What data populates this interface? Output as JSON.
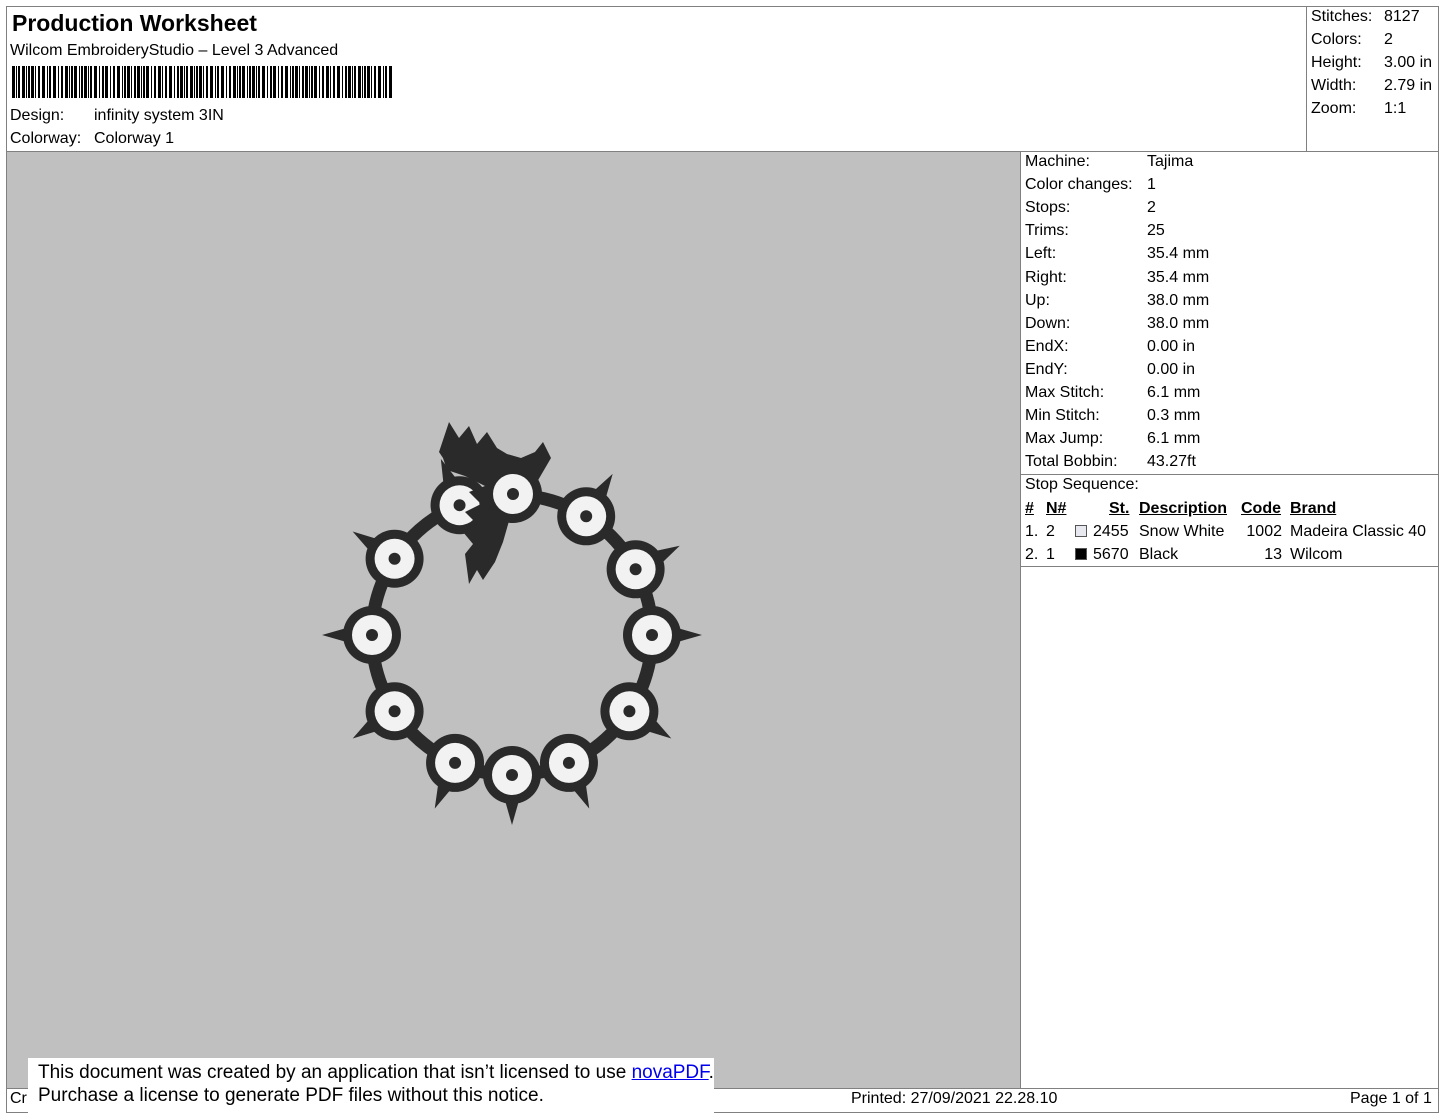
{
  "header": {
    "title": "Production Worksheet",
    "application": "Wilcom EmbroideryStudio – Level 3 Advanced",
    "design_label": "Design:",
    "design_value": "infinity system 3IN",
    "colorway_label": "Colorway:",
    "colorway_value": "Colorway 1"
  },
  "stats": [
    {
      "label": "Stitches:",
      "value": "8127"
    },
    {
      "label": "Colors:",
      "value": "2"
    },
    {
      "label": "Height:",
      "value": "3.00 in"
    },
    {
      "label": "Width:",
      "value": "2.79 in"
    },
    {
      "label": "Zoom:",
      "value": "1:1"
    }
  ],
  "details": [
    {
      "label": "Machine:",
      "value": "Tajima"
    },
    {
      "label": "Color changes:",
      "value": "1"
    },
    {
      "label": "Stops:",
      "value": "2"
    },
    {
      "label": "Trims:",
      "value": "25"
    },
    {
      "label": "Left:",
      "value": "35.4 mm"
    },
    {
      "label": "Right:",
      "value": "35.4 mm"
    },
    {
      "label": "Up:",
      "value": "38.0 mm"
    },
    {
      "label": "Down:",
      "value": "38.0 mm"
    },
    {
      "label": "EndX:",
      "value": "0.00 in"
    },
    {
      "label": "EndY:",
      "value": "0.00 in"
    },
    {
      "label": "Max Stitch:",
      "value": "6.1 mm"
    },
    {
      "label": "Min Stitch:",
      "value": "0.3 mm"
    },
    {
      "label": "Max Jump:",
      "value": "6.1 mm"
    },
    {
      "label": "Total Bobbin:",
      "value": "43.27ft"
    }
  ],
  "stop_sequence": {
    "title": "Stop Sequence:",
    "headers": {
      "num": "#",
      "needle": "N#",
      "stitches": "St.",
      "description": "Description",
      "code": "Code",
      "brand": "Brand"
    },
    "rows": [
      {
        "num": "1.",
        "needle": "2",
        "color": "#e8e8f0",
        "stitches": "2455",
        "description": "Snow White",
        "code": "1002",
        "brand": "Madeira Classic 40"
      },
      {
        "num": "2.",
        "needle": "1",
        "color": "#000000",
        "stitches": "5670",
        "description": "Black",
        "code": "13",
        "brand": "Wilcom"
      }
    ]
  },
  "footer": {
    "left_fragment": "Cr",
    "printed": "Printed: 27/09/2021 22.28.10",
    "page": "Page 1 of 1"
  },
  "notice": {
    "line1_prefix": "This document was created by an application that isn’t licensed to use ",
    "link": "novaPDF",
    "line1_suffix": ".",
    "line2": "Purchase a license to generate PDF files without this notice."
  },
  "colors": {
    "preview_background": "#c0c0c0",
    "thread_black": "#2a2a2a",
    "thread_white": "#f2f2f2"
  }
}
